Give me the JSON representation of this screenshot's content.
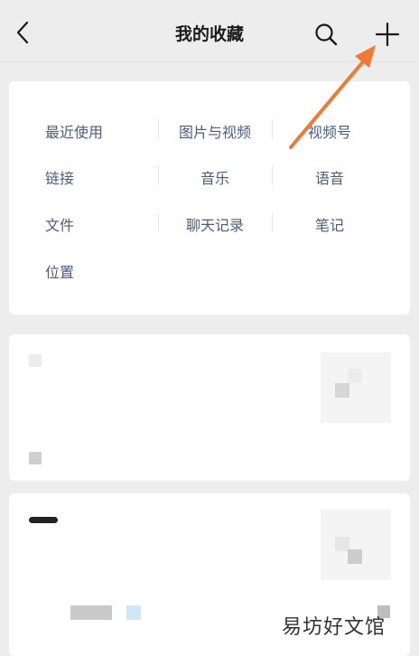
{
  "header": {
    "title": "我的收藏"
  },
  "categories": {
    "recent": "最近使用",
    "images_videos": "图片与视频",
    "channels": "视频号",
    "links": "链接",
    "music": "音乐",
    "voice": "语音",
    "files": "文件",
    "chat_history": "聊天记录",
    "notes": "笔记",
    "location": "位置"
  },
  "watermark": "易坊好文馆",
  "colors": {
    "accent_arrow": "#f07a35",
    "category_text": "#4b5d7c",
    "background": "#ededed"
  }
}
